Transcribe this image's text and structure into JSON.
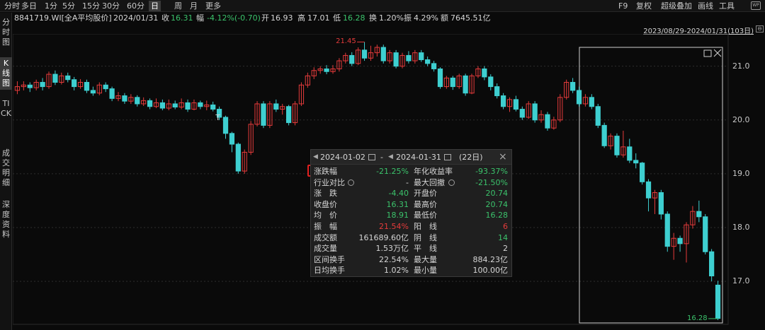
{
  "toolbar": {
    "periods": [
      {
        "label": "分时",
        "active": false
      },
      {
        "label": "多日",
        "active": false
      },
      {
        "label": "1分",
        "active": false
      },
      {
        "label": "5分",
        "active": false
      },
      {
        "label": "15分",
        "active": false
      },
      {
        "label": "30分",
        "active": false
      },
      {
        "label": "60分",
        "active": false
      },
      {
        "label": "日",
        "active": true
      },
      {
        "label": "周",
        "active": false
      },
      {
        "label": "月",
        "active": false
      },
      {
        "label": "更多",
        "active": false
      }
    ],
    "right": [
      "F9",
      "复权",
      "超级叠加",
      "画线",
      "工具"
    ],
    "wp_icon": "WP"
  },
  "info": {
    "code_name": "8841719.WI[全A平均股价]",
    "date": "2024/01/31",
    "close_label": "收",
    "close": "16.31",
    "change_label": "幅",
    "change": "-4.12%(-0.70)",
    "open_label": "开",
    "open": "16.93",
    "high_label": "高",
    "high": "17.01",
    "low_label": "低",
    "low": "16.28",
    "turnover_label": "换",
    "turnover": "1.20%",
    "amplitude_label": "振",
    "amplitude": "4.29%",
    "amount_label": "额",
    "amount": "7645.51亿"
  },
  "date_range": "2023/08/29-2024/01/31(103日)",
  "zoom_button": "⊖",
  "vertical_tabs": [
    {
      "label": "分时图",
      "active": false
    },
    {
      "label": "K线图",
      "active": true
    },
    {
      "label": "TICK",
      "active": false
    },
    {
      "label": "成交明细",
      "active": false
    },
    {
      "label": "深度资料",
      "active": false
    }
  ],
  "chart_data": {
    "type": "candlestick",
    "ylim": [
      16.2,
      21.6
    ],
    "y_ticks": [
      "21.0",
      "20.0",
      "19.0",
      "18.0",
      "17.0"
    ],
    "annotations": {
      "max_label": "21.45",
      "min_label": "16.28",
      "cursor_marker": "T"
    },
    "up_color": "#e43b3b",
    "down_color": "#3ecfd0",
    "candles": [
      [
        20.55,
        20.62,
        20.72,
        20.48
      ],
      [
        20.62,
        20.65,
        20.72,
        20.55
      ],
      [
        20.65,
        20.6,
        20.7,
        20.52
      ],
      [
        20.6,
        20.7,
        20.75,
        20.55
      ],
      [
        20.7,
        20.62,
        20.78,
        20.55
      ],
      [
        20.62,
        20.85,
        20.9,
        20.58
      ],
      [
        20.85,
        20.7,
        20.92,
        20.65
      ],
      [
        20.7,
        20.82,
        20.88,
        20.66
      ],
      [
        20.82,
        20.75,
        20.88,
        20.7
      ],
      [
        20.75,
        20.62,
        20.8,
        20.55
      ],
      [
        20.62,
        20.7,
        20.76,
        20.58
      ],
      [
        20.7,
        20.55,
        20.75,
        20.5
      ],
      [
        20.55,
        20.5,
        20.62,
        20.45
      ],
      [
        20.5,
        20.65,
        20.7,
        20.46
      ],
      [
        20.65,
        20.58,
        20.7,
        20.52
      ],
      [
        20.58,
        20.4,
        20.62,
        20.35
      ],
      [
        20.4,
        20.45,
        20.52,
        20.35
      ],
      [
        20.45,
        20.35,
        20.5,
        20.3
      ],
      [
        20.35,
        20.42,
        20.48,
        20.3
      ],
      [
        20.42,
        20.3,
        20.46,
        20.25
      ],
      [
        20.3,
        20.36,
        20.42,
        20.26
      ],
      [
        20.36,
        20.25,
        20.4,
        20.2
      ],
      [
        20.25,
        20.32,
        20.4,
        20.22
      ],
      [
        20.32,
        20.22,
        20.38,
        20.18
      ],
      [
        20.22,
        20.3,
        20.38,
        20.18
      ],
      [
        20.3,
        20.24,
        20.36,
        20.2
      ],
      [
        20.24,
        20.32,
        20.4,
        20.2
      ],
      [
        20.32,
        20.2,
        20.38,
        20.15
      ],
      [
        20.2,
        20.32,
        20.38,
        20.18
      ],
      [
        20.32,
        20.25,
        20.36,
        20.2
      ],
      [
        20.25,
        20.28,
        20.36,
        20.18
      ],
      [
        20.28,
        20.2,
        20.34,
        20.16
      ],
      [
        20.2,
        20.05,
        20.25,
        20.0
      ],
      [
        20.05,
        19.75,
        20.08,
        19.65
      ],
      [
        19.75,
        19.55,
        19.78,
        19.4
      ],
      [
        19.55,
        19.05,
        19.58,
        19.0
      ],
      [
        19.05,
        19.4,
        19.45,
        19.0
      ],
      [
        19.4,
        19.92,
        19.98,
        19.35
      ],
      [
        19.92,
        20.3,
        20.35,
        19.88
      ],
      [
        20.3,
        19.9,
        20.35,
        19.85
      ],
      [
        19.9,
        20.3,
        20.35,
        19.85
      ],
      [
        20.3,
        20.2,
        20.38,
        20.15
      ],
      [
        20.2,
        20.25,
        20.3,
        20.1
      ],
      [
        20.25,
        19.95,
        20.28,
        19.9
      ],
      [
        19.95,
        20.3,
        20.35,
        19.9
      ],
      [
        20.3,
        20.65,
        20.7,
        20.26
      ],
      [
        20.65,
        20.82,
        20.88,
        20.6
      ],
      [
        20.82,
        20.92,
        20.98,
        20.76
      ],
      [
        20.92,
        20.95,
        21.0,
        20.86
      ],
      [
        20.95,
        20.9,
        21.02,
        20.85
      ],
      [
        20.9,
        20.95,
        21.02,
        20.86
      ],
      [
        20.95,
        21.1,
        21.15,
        20.9
      ],
      [
        21.1,
        21.2,
        21.25,
        21.05
      ],
      [
        21.2,
        21.05,
        21.26,
        21.0
      ],
      [
        21.05,
        21.3,
        21.35,
        21.02
      ],
      [
        21.3,
        21.15,
        21.45,
        21.1
      ],
      [
        21.15,
        21.25,
        21.38,
        21.1
      ],
      [
        21.25,
        21.35,
        21.4,
        21.18
      ],
      [
        21.35,
        21.1,
        21.4,
        21.05
      ],
      [
        21.1,
        21.25,
        21.3,
        21.05
      ],
      [
        21.25,
        21.0,
        21.3,
        20.96
      ],
      [
        21.0,
        21.2,
        21.25,
        20.96
      ],
      [
        21.2,
        21.1,
        21.28,
        21.05
      ],
      [
        21.1,
        21.25,
        21.3,
        21.05
      ],
      [
        21.25,
        21.12,
        21.3,
        21.08
      ],
      [
        21.12,
        21.05,
        21.18,
        21.0
      ],
      [
        21.05,
        20.95,
        21.1,
        20.9
      ],
      [
        20.95,
        20.62,
        20.98,
        20.58
      ],
      [
        20.62,
        20.78,
        20.82,
        20.58
      ],
      [
        20.78,
        20.62,
        20.82,
        20.56
      ],
      [
        20.62,
        20.82,
        20.86,
        20.58
      ],
      [
        20.82,
        20.5,
        20.86,
        20.45
      ],
      [
        20.5,
        20.82,
        20.86,
        20.48
      ],
      [
        20.82,
        20.95,
        21.0,
        20.78
      ],
      [
        20.95,
        20.8,
        21.0,
        20.74
      ],
      [
        20.8,
        20.62,
        20.85,
        20.55
      ],
      [
        20.62,
        20.45,
        20.68,
        20.4
      ],
      [
        20.45,
        20.25,
        20.5,
        20.2
      ],
      [
        20.25,
        20.38,
        20.42,
        20.15
      ],
      [
        20.38,
        20.2,
        20.45,
        20.16
      ],
      [
        20.2,
        20.05,
        20.25,
        20.0
      ],
      [
        20.05,
        20.3,
        20.35,
        20.02
      ],
      [
        20.3,
        20.0,
        20.35,
        19.95
      ],
      [
        20.0,
        20.1,
        20.18,
        19.95
      ],
      [
        20.1,
        19.85,
        20.15,
        19.8
      ],
      [
        19.85,
        20.0,
        20.06,
        19.82
      ],
      [
        20.0,
        20.42,
        20.48,
        19.96
      ],
      [
        20.42,
        20.7,
        20.75,
        20.38
      ],
      [
        20.7,
        20.55,
        20.78,
        20.5
      ],
      [
        20.55,
        20.3,
        20.62,
        20.25
      ],
      [
        20.3,
        20.42,
        20.48,
        20.25
      ],
      [
        20.42,
        20.25,
        20.48,
        20.2
      ],
      [
        20.25,
        19.9,
        20.3,
        19.85
      ],
      [
        19.9,
        19.52,
        19.95,
        19.48
      ],
      [
        19.52,
        19.7,
        19.75,
        19.45
      ],
      [
        19.7,
        19.35,
        19.75,
        19.3
      ],
      [
        19.35,
        19.5,
        19.8,
        19.3
      ],
      [
        19.5,
        19.25,
        19.65,
        19.2
      ],
      [
        19.25,
        19.2,
        19.38,
        19.1
      ],
      [
        19.2,
        18.85,
        19.22,
        18.8
      ],
      [
        18.85,
        18.55,
        18.9,
        18.3
      ],
      [
        18.55,
        18.65,
        18.7,
        18.25
      ],
      [
        18.65,
        18.25,
        18.7,
        18.15
      ],
      [
        18.25,
        17.65,
        18.3,
        17.55
      ],
      [
        17.65,
        17.8,
        17.9,
        17.4
      ],
      [
        17.8,
        17.7,
        17.85,
        17.55
      ],
      [
        17.7,
        18.05,
        18.1,
        17.35
      ],
      [
        18.05,
        18.3,
        18.4,
        17.98
      ],
      [
        18.3,
        18.2,
        18.5,
        18.1
      ],
      [
        18.2,
        17.55,
        18.25,
        17.5
      ],
      [
        17.55,
        17.1,
        17.6,
        17.0
      ],
      [
        16.93,
        16.31,
        17.01,
        16.28
      ]
    ]
  },
  "panel": {
    "range_start": "2024-01-02",
    "range_sep": "-",
    "range_end": "2024-01-31",
    "range_days": "(22日)",
    "close_icon": "×",
    "rows": [
      {
        "l1": "涨跌幅",
        "v1": "-21.25%",
        "c1": "g",
        "l2": "年化收益率",
        "v2": "-93.37%",
        "c2": "g"
      },
      {
        "l1": "行业对比",
        "v1": "-",
        "c1": "w",
        "l2": "最大回撤",
        "v2": "-21.50%",
        "c2": "g"
      },
      {
        "l1": "涨　跌",
        "v1": "-4.40",
        "c1": "g",
        "l2": "开盘价",
        "v2": "20.74",
        "c2": "g"
      },
      {
        "l1": "收盘价",
        "v1": "16.31",
        "c1": "g",
        "l2": "最高价",
        "v2": "20.74",
        "c2": "g"
      },
      {
        "l1": "均　价",
        "v1": "18.91",
        "c1": "g",
        "l2": "最低价",
        "v2": "16.28",
        "c2": "g"
      },
      {
        "l1": "振　幅",
        "v1": "21.54%",
        "c1": "r",
        "l2": "阳　线",
        "v2": "6",
        "c2": "r"
      },
      {
        "l1": "成交额",
        "v1": "161689.60亿",
        "c1": "w",
        "l2": "阴　线",
        "v2": "14",
        "c2": "g"
      },
      {
        "l1": "成交量",
        "v1": "1.53万亿",
        "c1": "w",
        "l2": "平　线",
        "v2": "2",
        "c2": "w"
      },
      {
        "l1": "区间换手",
        "v1": "22.54%",
        "c1": "w",
        "l2": "最大量",
        "v2": "884.23亿",
        "c2": "w"
      },
      {
        "l1": "日均换手",
        "v1": "1.02%",
        "c1": "w",
        "l2": "最小量",
        "v2": "100.00亿",
        "c2": "w"
      }
    ]
  }
}
